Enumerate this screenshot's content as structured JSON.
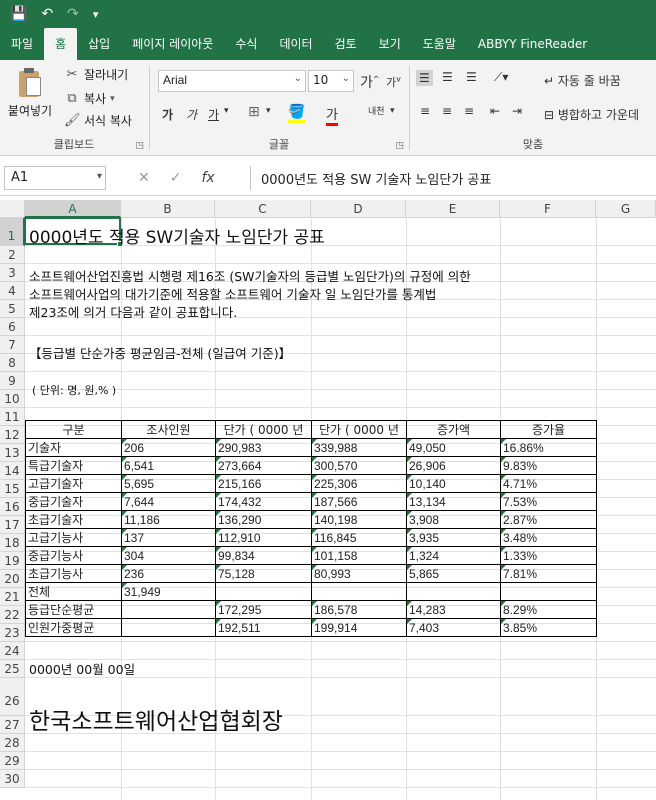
{
  "qat": {
    "save": "💾",
    "undo": "↶",
    "redo": "↷",
    "customize": "▾"
  },
  "tabs": [
    "파일",
    "홈",
    "삽입",
    "페이지 레이아웃",
    "수식",
    "데이터",
    "검토",
    "보기",
    "도움말",
    "ABBYY FineReader"
  ],
  "active_tab": "홈",
  "ribbon": {
    "paste": "붙여넣기",
    "cut": "잘라내기",
    "copy": "복사",
    "format_painter": "서식 복사",
    "clipboard_group": "클립보드",
    "font_name": "Arial",
    "font_size": "10",
    "grow_font": "가",
    "shrink_font": "가",
    "bold": "가",
    "italic": "가",
    "underline": "가",
    "font_color": "가",
    "phonetic": "내천",
    "font_group": "글꼴",
    "wrap_text": "자동 줄 바꿈",
    "merge_center": "병합하고 가운데",
    "align_group": "맞춤"
  },
  "formula_bar": {
    "name_box": "A1",
    "fx": "fx",
    "content": "0000년도 적용 SW 기술자 노임단가 공표"
  },
  "columns": [
    "A",
    "B",
    "C",
    "D",
    "E",
    "F",
    "G"
  ],
  "rows": [
    "1",
    "2",
    "3",
    "4",
    "5",
    "6",
    "7",
    "8",
    "9",
    "10",
    "11",
    "12",
    "13",
    "14",
    "15",
    "16",
    "17",
    "18",
    "19",
    "20",
    "21",
    "22",
    "23",
    "24",
    "25",
    "26",
    "27",
    "28",
    "29",
    "30"
  ],
  "cells": {
    "A1": "0000년도 적용 SW기술자 노임단가 공표",
    "A3": "소프트웨어산업진흥법 시행령 제16조 (SW기술자의 등급별 노임단가)의 규정에 의한",
    "A4": "소프트웨어사업의 대가기준에 적용할 소프트웨어 기술자 일 노임단가를 통계법",
    "A5": "제23조에 의거 다음과 같이 공표합니다.",
    "A7": "【등급별 단순가중 평균임금-전체 (일급여 기준)】",
    "A9": "( 단위: 명, 원,% )",
    "A24": "0000년 00월 00일",
    "A26": "한국소프트웨어산업협회장"
  },
  "table": {
    "headers": [
      "구분",
      "조사인원",
      "단가 ( 0000 년",
      "단가 ( 0000 년",
      "증가액",
      "증가율"
    ],
    "rows": [
      [
        "기술자",
        "206",
        "290,983",
        "339,988",
        "49,050",
        "16.86%"
      ],
      [
        "특급기술자",
        "6,541",
        "273,664",
        "300,570",
        "26,906",
        "9.83%"
      ],
      [
        "고급기술자",
        "5,695",
        "215,166",
        "225,306",
        "10,140",
        "4.71%"
      ],
      [
        "중급기술자",
        "7,644",
        "174,432",
        "187,566",
        "13,134",
        "7.53%"
      ],
      [
        "초급기술자",
        "11,186",
        "136,290",
        "140,198",
        "3,908",
        "2.87%"
      ],
      [
        "고급기능사",
        "137",
        "112,910",
        "116,845",
        "3,935",
        "3.48%"
      ],
      [
        "중급기능사",
        "304",
        "99,834",
        "101,158",
        "1,324",
        "1.33%"
      ],
      [
        "초급기능사",
        "236",
        "75,128",
        "80,993",
        "5,865",
        "7.81%"
      ],
      [
        "전체",
        "31,949",
        "",
        "",
        "",
        ""
      ],
      [
        "등급단순평균",
        "",
        "172,295",
        "186,578",
        "14,283",
        "8.29%"
      ],
      [
        "인원가중평균",
        "",
        "192,511",
        "199,914",
        "7,403",
        "3.85%"
      ]
    ]
  }
}
